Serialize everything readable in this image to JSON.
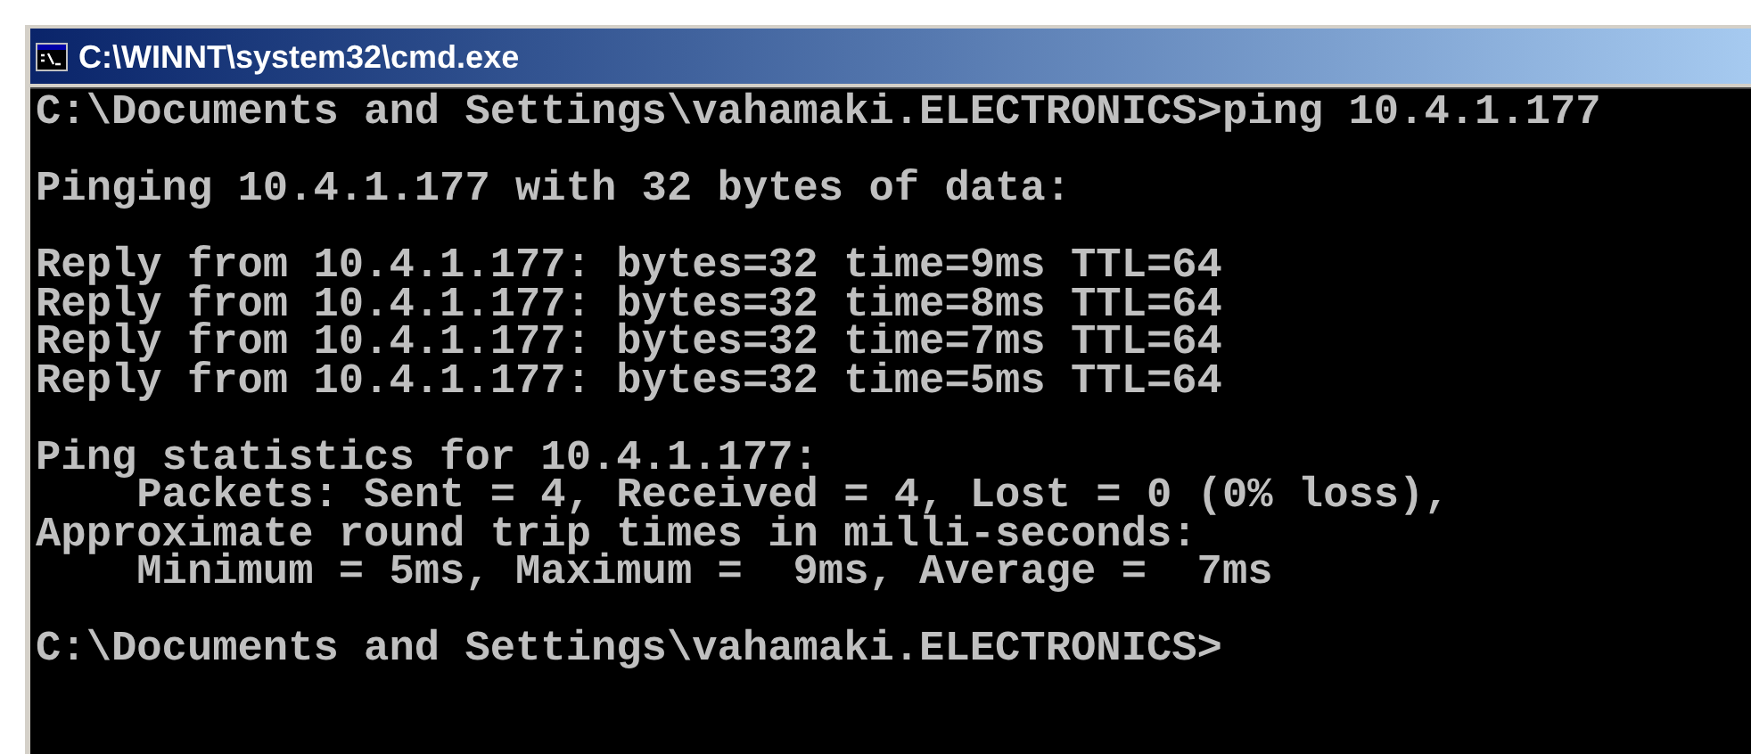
{
  "window": {
    "title": "C:\\WINNT\\system32\\cmd.exe"
  },
  "console": {
    "blocks": [
      [
        "C:\\Documents and Settings\\vahamaki.ELECTRONICS>ping 10.4.1.177"
      ],
      [
        "Pinging 10.4.1.177 with 32 bytes of data:"
      ],
      [
        "Reply from 10.4.1.177: bytes=32 time=9ms TTL=64",
        "Reply from 10.4.1.177: bytes=32 time=8ms TTL=64",
        "Reply from 10.4.1.177: bytes=32 time=7ms TTL=64",
        "Reply from 10.4.1.177: bytes=32 time=5ms TTL=64"
      ],
      [
        "Ping statistics for 10.4.1.177:",
        "    Packets: Sent = 4, Received = 4, Lost = 0 (0% loss),",
        "Approximate round trip times in milli-seconds:",
        "    Minimum = 5ms, Maximum =  9ms, Average =  7ms"
      ],
      [
        "C:\\Documents and Settings\\vahamaki.ELECTRONICS>"
      ]
    ]
  }
}
